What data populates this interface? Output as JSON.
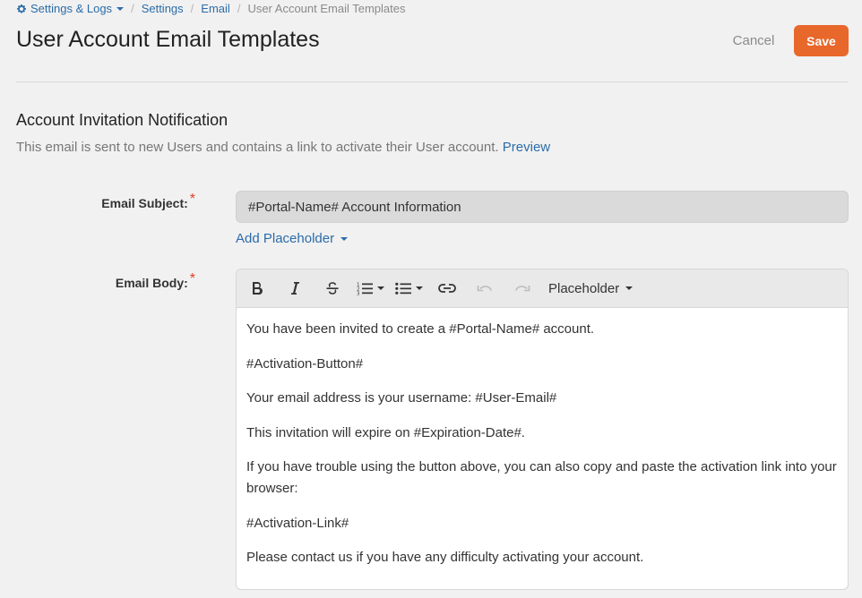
{
  "breadcrumb": {
    "items": [
      "Settings & Logs",
      "Settings",
      "Email"
    ],
    "current": "User Account Email Templates"
  },
  "header": {
    "title": "User Account Email Templates",
    "cancel_label": "Cancel",
    "save_label": "Save"
  },
  "section": {
    "title": "Account Invitation Notification",
    "description": "This email is sent to new Users and contains a link to activate their User account.",
    "preview_label": "Preview"
  },
  "form": {
    "subject_label": "Email Subject:",
    "subject_value": "#Portal-Name# Account Information",
    "add_placeholder_label": "Add Placeholder",
    "body_label": "Email Body:",
    "toolbar_placeholder_label": "Placeholder",
    "body_paragraphs": [
      "You have been invited to create a #Portal-Name# account.",
      "#Activation-Button#",
      "Your email address is your username: #User-Email#",
      "This invitation will expire on #Expiration-Date#.",
      "If you have trouble using the button above, you can also copy and paste the activation link into your browser:",
      "#Activation-Link#",
      "Please contact us if you have any difficulty activating your account."
    ]
  },
  "colors": {
    "accent": "#e8672a",
    "link": "#2b6ca8",
    "required": "#e0402a",
    "background": "#f1f1f1"
  },
  "icons": [
    "gear-icon",
    "bold-icon",
    "italic-icon",
    "strikethrough-icon",
    "ordered-list-icon",
    "unordered-list-icon",
    "link-icon",
    "undo-icon",
    "redo-icon"
  ]
}
